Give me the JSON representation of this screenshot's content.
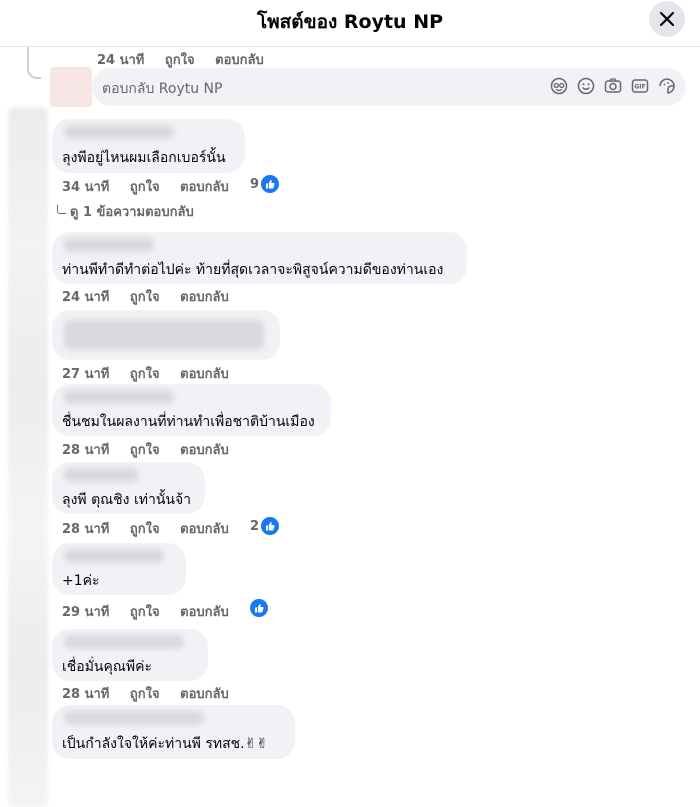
{
  "header": {
    "title": "โพสต์ของ Roytu NP"
  },
  "top_meta": {
    "time": "24 นาที",
    "like": "ถูกใจ",
    "reply": "ตอบกลับ"
  },
  "reply_box": {
    "placeholder": "ตอบกลับ Roytu NP"
  },
  "view_replies": "ดู 1 ข้อความตอบกลับ",
  "comments": [
    {
      "text": "ลุงพีอยู่ไหนผมเลือกเบอร์นั้น",
      "time": "34 นาที",
      "like": "ถูกใจ",
      "reply": "ตอบกลับ",
      "likes": "9"
    },
    {
      "text": "ท่านพีทำดีทำต่อไปค่ะ ท้ายที่สุดเวลาจะพิสูจน์ความดีของท่านเอง",
      "time": "24 นาที",
      "like": "ถูกใจ",
      "reply": "ตอบกลับ",
      "likes": ""
    },
    {
      "text": "",
      "time": "27 นาที",
      "like": "ถูกใจ",
      "reply": "ตอบกลับ",
      "likes": ""
    },
    {
      "text": "ชื่นชมในผลงานที่ท่านทำเพื่อชาติบ้านเมือง",
      "time": "28 นาที",
      "like": "ถูกใจ",
      "reply": "ตอบกลับ",
      "likes": ""
    },
    {
      "text": "ลุงพี ตุณชิง เท่านั้นจ้า",
      "time": "28 นาที",
      "like": "ถูกใจ",
      "reply": "ตอบกลับ",
      "likes": "2"
    },
    {
      "text": "+1ค่ะ",
      "time": "29 นาที",
      "like": "ถูกใจ",
      "reply": "ตอบกลับ",
      "likes": ""
    },
    {
      "text": "เชื่อมั่นคุณพีค่ะ",
      "time": "28 นาที",
      "like": "ถูกใจ",
      "reply": "ตอบกลับ",
      "likes": ""
    },
    {
      "text": "เป็นกำลังใจให้ค่ะท่านพี รทสช.✌✌",
      "time": "",
      "like": "",
      "reply": "",
      "likes": ""
    }
  ],
  "colors": {
    "accent": "#1877f2",
    "bubble": "#f0f2f5",
    "meta": "#65676b"
  },
  "icons": [
    "close-icon",
    "sticker-icon",
    "emoji-icon",
    "camera-icon",
    "gif-icon",
    "avatar-sticker-icon",
    "like-reaction-icon"
  ]
}
